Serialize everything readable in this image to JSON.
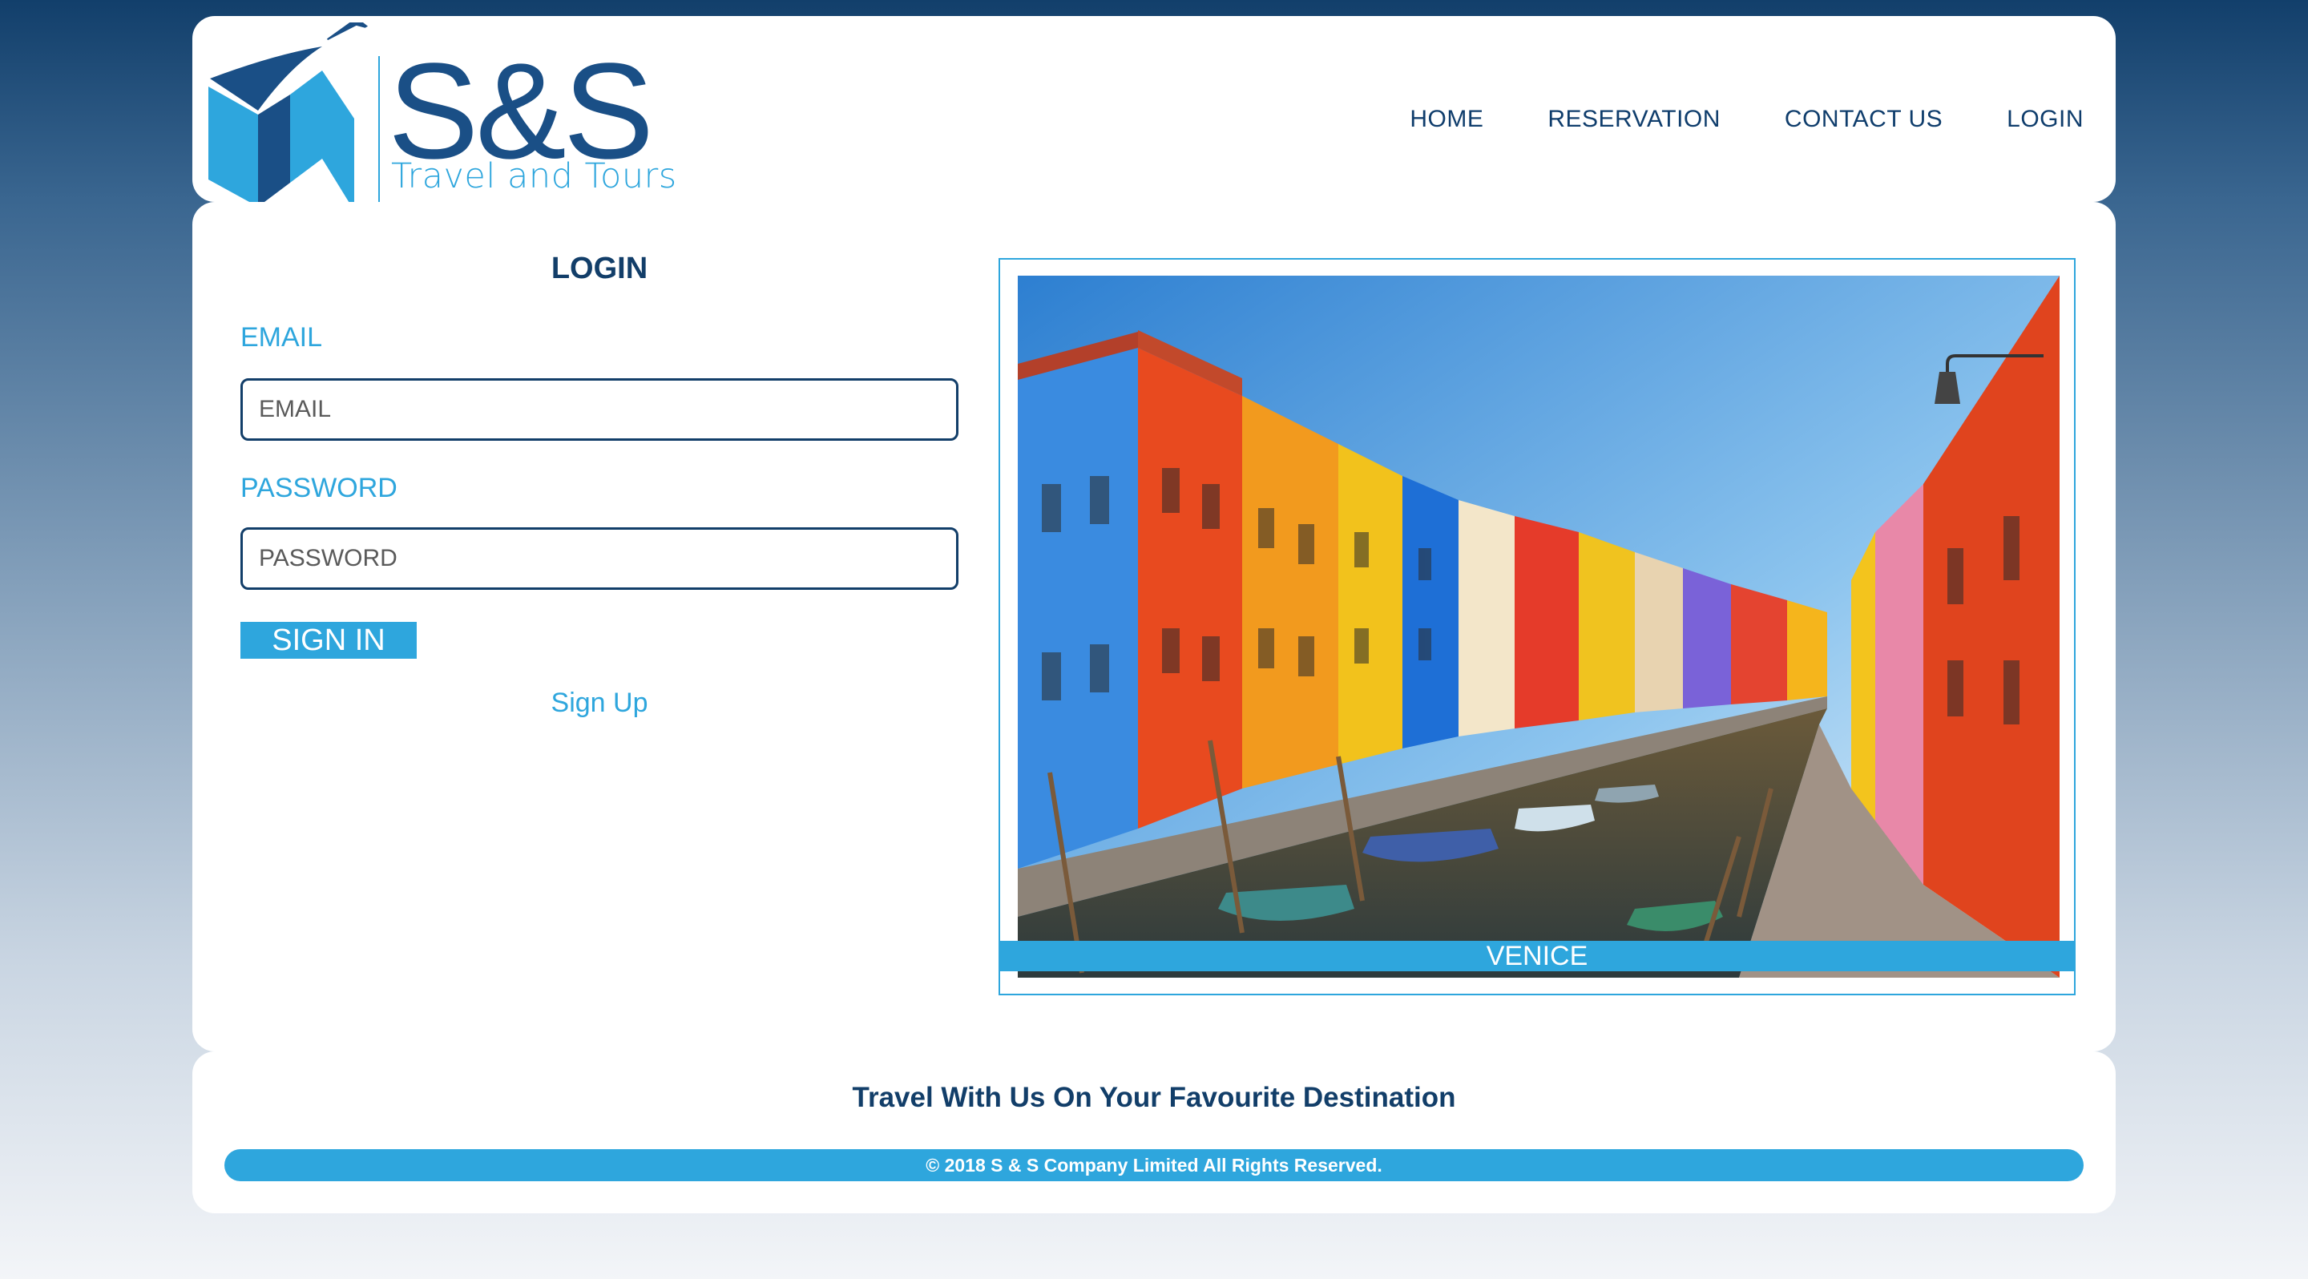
{
  "logo": {
    "title": "S&S",
    "subtitle": "Travel and Tours"
  },
  "nav": {
    "items": [
      {
        "label": "HOME"
      },
      {
        "label": "RESERVATION"
      },
      {
        "label": "CONTACT US"
      },
      {
        "label": "LOGIN"
      }
    ]
  },
  "login": {
    "title": "LOGIN",
    "email_label": "EMAIL",
    "email_placeholder": "EMAIL",
    "password_label": "PASSWORD",
    "password_placeholder": "PASSWORD",
    "signin_label": "SIGN IN",
    "signup_label": "Sign Up"
  },
  "photo": {
    "caption": "VENICE"
  },
  "footer": {
    "tagline": "Travel With Us On Your Favourite Destination",
    "copyright": "© 2018 S & S Company Limited All Rights Reserved."
  },
  "colors": {
    "accent": "#2ea6dd",
    "navy": "#123e69",
    "background_top": "#123f6b"
  }
}
